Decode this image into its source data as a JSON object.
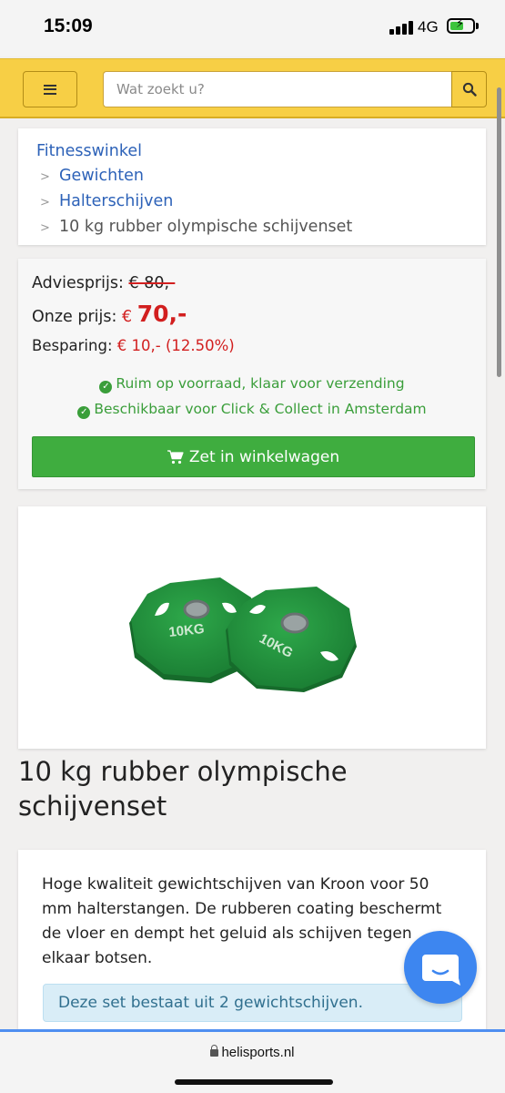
{
  "status_bar": {
    "time": "15:09",
    "network": "4G",
    "battery_level": 0.6
  },
  "header": {
    "search_placeholder": "Wat zoekt u?"
  },
  "breadcrumb": {
    "items": [
      "Fitnesswinkel",
      "Gewichten",
      "Halterschijven"
    ],
    "current": "10 kg rubber olympische schijvenset"
  },
  "pricing": {
    "advice_label": "Adviesprijs:",
    "advice_value": "€ 80,-",
    "our_label": "Onze prijs:",
    "currency": "€",
    "our_value": "70,-",
    "saving_label": "Besparing:",
    "saving_value": "€ 10,- (12.50%)",
    "stock_status": "Ruim op voorraad, klaar voor verzending",
    "pickup_status": "Beschikbaar voor Click & Collect in Amsterdam",
    "cart_button": "Zet in winkelwagen"
  },
  "product": {
    "plate_label": "10KG",
    "title": "10 kg rubber olympische schijvenset",
    "description": "Hoge kwaliteit gewichtschijven van Kroon voor 50 mm halterstangen. De rubberen coating beschermt de vloer en dempt het geluid als schijven tegen elkaar botsen.",
    "info": "Deze set bestaat uit 2 gewichtschijven."
  },
  "browser": {
    "url": "helisports.nl"
  },
  "colors": {
    "accent": "#f7cf45",
    "link": "#2d62b8",
    "price_red": "#d21f1f",
    "success_green": "#3fad3f",
    "chat_blue": "#3d86f0"
  }
}
